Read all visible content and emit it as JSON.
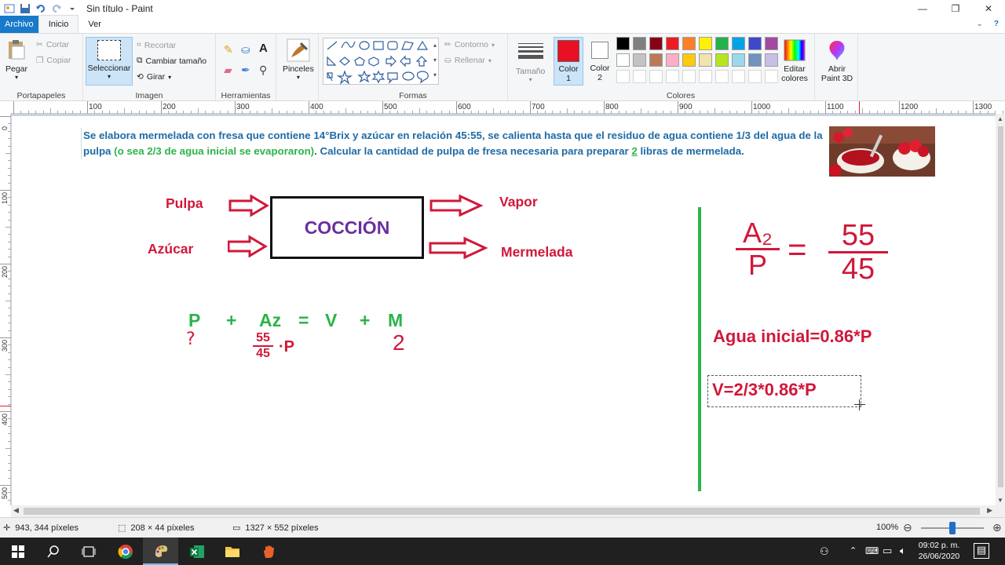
{
  "window": {
    "title": "Sin título - Paint"
  },
  "tabs": {
    "file": "Archivo",
    "home": "Inicio",
    "view": "Ver"
  },
  "ribbon": {
    "clipboard": {
      "label": "Portapapeles",
      "paste": "Pegar",
      "cut": "Cortar",
      "copy": "Copiar"
    },
    "image": {
      "label": "Imagen",
      "select": "Seleccionar",
      "crop": "Recortar",
      "resize": "Cambiar tamaño",
      "rotate": "Girar"
    },
    "tools": {
      "label": "Herramientas"
    },
    "brushes": {
      "label": "Pinceles"
    },
    "shapes": {
      "label": "Formas",
      "outline": "Contorno",
      "fill": "Rellenar"
    },
    "size": {
      "label": "Tamaño"
    },
    "color1": {
      "label1": "Color",
      "label2": "1",
      "value": "#e81123"
    },
    "color2": {
      "label1": "Color",
      "label2": "2",
      "value": "#ffffff"
    },
    "colors": {
      "label": "Colores",
      "row1": [
        "#000000",
        "#7f7f7f",
        "#880015",
        "#ed1c24",
        "#ff7f27",
        "#fff200",
        "#22b14c",
        "#00a2e8",
        "#3f48cc",
        "#a349a4"
      ],
      "row2": [
        "#ffffff",
        "#c3c3c3",
        "#b97a57",
        "#ffaec9",
        "#ffc90e",
        "#efe4b0",
        "#b5e61d",
        "#99d9ea",
        "#7092be",
        "#c8bfe7"
      ]
    },
    "edit_colors": {
      "line1": "Editar",
      "line2": "colores"
    },
    "paint3d": {
      "line1": "Abrir",
      "line2": "Paint 3D"
    }
  },
  "ruler": {
    "h": [
      "100",
      "200",
      "300",
      "400",
      "500",
      "600",
      "700",
      "800",
      "900",
      "1000",
      "1100",
      "1200",
      "1300"
    ],
    "v": [
      "0",
      "100",
      "200",
      "300",
      "400",
      "500"
    ]
  },
  "canvas": {
    "problem": {
      "part1": "Se elabora mermelada con fresa que contiene 14°Brix y azúcar en relación 45:55, se calienta hasta que el residuo de agua contiene 1/3 del agua de la pulpa ",
      "part2": "(o sea 2/3 de agua inicial se evaporaron)",
      "part3": ". Calcular la cantidad de pulpa de fresa necesaria para preparar ",
      "part4": "2",
      "part5": " libras de mermelada."
    },
    "inputs": {
      "pulp": "Pulpa",
      "sugar": "Azúcar"
    },
    "process": "COCCIÓN",
    "outputs": {
      "vapor": "Vapor",
      "jam": "Mermelada"
    },
    "equation": {
      "p": "P",
      "plus1": "+",
      "az": "Az",
      "eq": "=",
      "v": "V",
      "plus2": "+",
      "m": "M"
    },
    "under": {
      "p": "?",
      "az_num": "55",
      "az_den": "45",
      "az_mult": "·P",
      "m": "2"
    },
    "ratio": {
      "num_left": "A₂",
      "den_left": "P",
      "eq": "=",
      "num_right": "55",
      "den_right": "45"
    },
    "water": "Agua inicial=0.86*P",
    "vapor_eq": "V=2/3*0.86*P"
  },
  "status": {
    "cursor": "943, 344 píxeles",
    "selection": "208 × 44 píxeles",
    "size": "1327 × 552 píxeles",
    "zoom": "100%"
  },
  "taskbar": {
    "time": "09:02 p. m.",
    "date": "26/06/2020"
  }
}
